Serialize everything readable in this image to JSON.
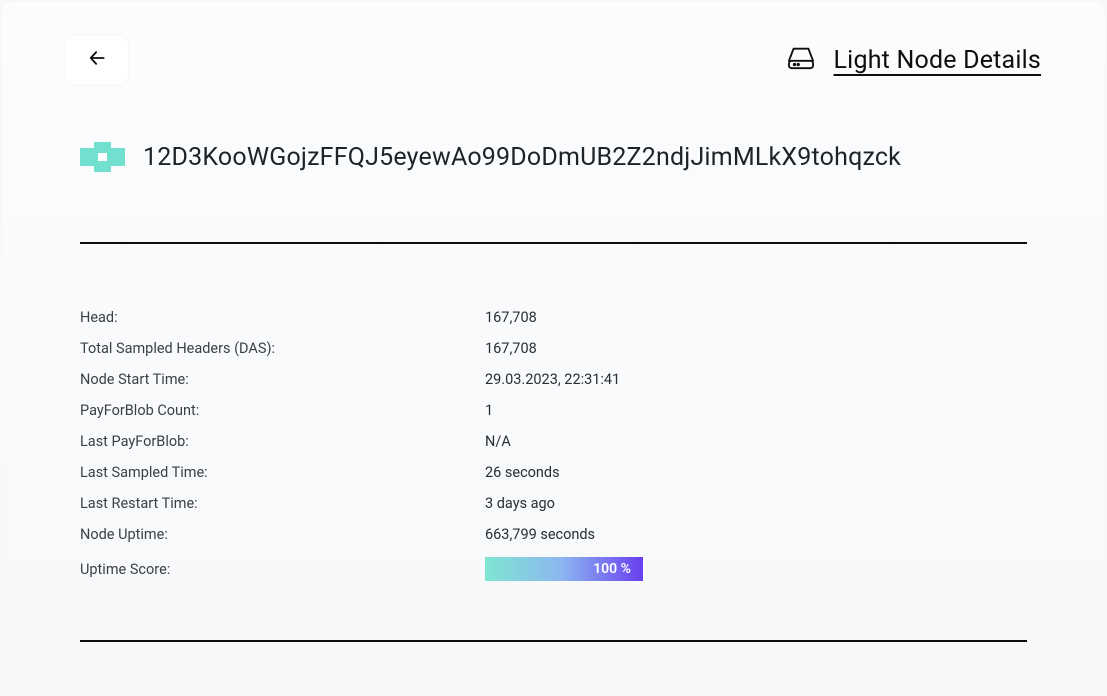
{
  "header": {
    "title": "Light Node Details"
  },
  "node": {
    "id": "12D3KooWGojzFFQJ5eyewAo99DoDmUB2Z2ndjJimMLkX9tohqzck"
  },
  "info": {
    "head_label": "Head:",
    "head_value": "167,708",
    "total_sampled_label": "Total Sampled Headers (DAS):",
    "total_sampled_value": "167,708",
    "start_time_label": "Node Start Time:",
    "start_time_value": "29.03.2023, 22:31:41",
    "pfb_count_label": "PayForBlob Count:",
    "pfb_count_value": "1",
    "last_pfb_label": "Last PayForBlob:",
    "last_pfb_value": "N/A",
    "last_sampled_label": "Last Sampled Time:",
    "last_sampled_value": "26 seconds",
    "last_restart_label": "Last Restart Time:",
    "last_restart_value": "3 days ago",
    "uptime_label": "Node Uptime:",
    "uptime_value": "663,799 seconds",
    "uptime_score_label": "Uptime Score:",
    "uptime_score_value": "100 %"
  }
}
